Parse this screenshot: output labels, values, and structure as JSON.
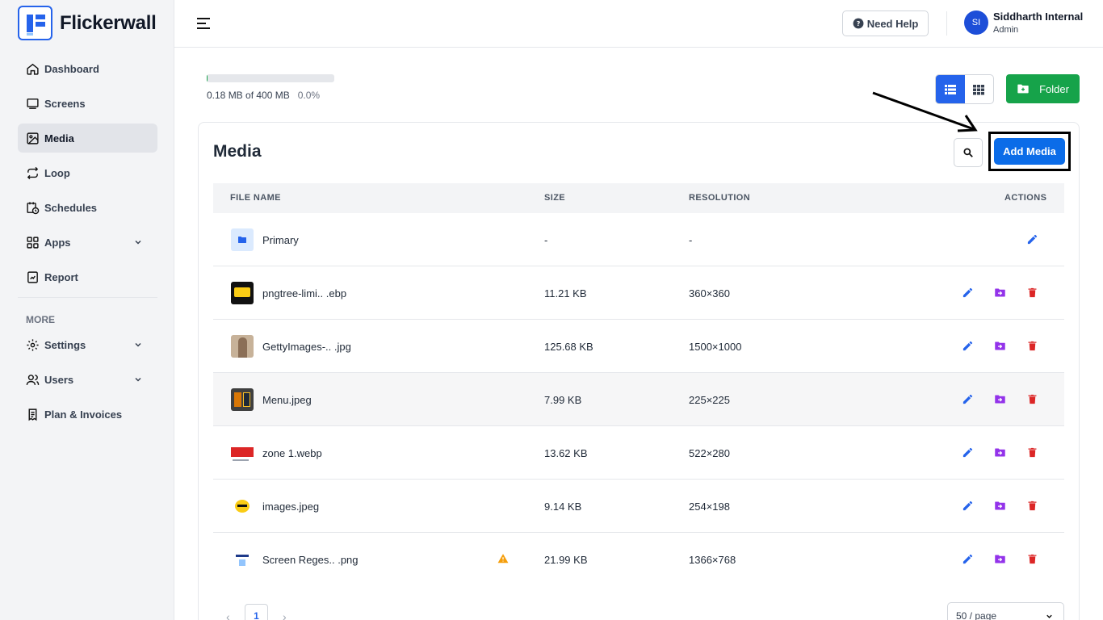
{
  "app": {
    "name": "Flickerwall"
  },
  "sidebar": {
    "items": [
      {
        "label": "Dashboard",
        "icon": "home-icon"
      },
      {
        "label": "Screens",
        "icon": "monitor-icon"
      },
      {
        "label": "Media",
        "icon": "image-icon",
        "active": true
      },
      {
        "label": "Loop",
        "icon": "loop-icon"
      },
      {
        "label": "Schedules",
        "icon": "calendar-clock-icon"
      },
      {
        "label": "Apps",
        "icon": "apps-grid-icon",
        "expandable": true
      },
      {
        "label": "Report",
        "icon": "report-icon"
      }
    ],
    "more_label": "MORE",
    "more_items": [
      {
        "label": "Settings",
        "icon": "gear-icon",
        "expandable": true
      },
      {
        "label": "Users",
        "icon": "users-icon",
        "expandable": true
      },
      {
        "label": "Plan & Invoices",
        "icon": "invoice-icon"
      }
    ]
  },
  "header": {
    "help_label": "Need Help",
    "user": {
      "initials": "SI",
      "name": "Siddharth Internal",
      "role": "Admin"
    }
  },
  "storage": {
    "used_text": "0.18 MB of 400 MB",
    "percent_text": "0.0%",
    "fraction": 0.004
  },
  "toolbar": {
    "folder_label": "Folder",
    "view_mode": "list"
  },
  "media": {
    "title": "Media",
    "add_label": "Add Media",
    "columns": {
      "name": "FILE NAME",
      "size": "SIZE",
      "resolution": "RESOLUTION",
      "actions": "ACTIONS"
    },
    "rows": [
      {
        "name": "Primary",
        "size": "-",
        "resolution": "-",
        "type": "folder"
      },
      {
        "name": "pngtree-limi.. .ebp",
        "size": "11.21 KB",
        "resolution": "360×360",
        "type": "file"
      },
      {
        "name": "GettyImages-.. .jpg",
        "size": "125.68 KB",
        "resolution": "1500×1000",
        "type": "file"
      },
      {
        "name": "Menu.jpeg",
        "size": "7.99 KB",
        "resolution": "225×225",
        "type": "file"
      },
      {
        "name": "zone 1.webp",
        "size": "13.62 KB",
        "resolution": "522×280",
        "type": "file"
      },
      {
        "name": "images.jpeg",
        "size": "9.14 KB",
        "resolution": "254×198",
        "type": "file"
      },
      {
        "name": "Screen Reges.. .png",
        "size": "21.99 KB",
        "resolution": "1366×768",
        "type": "file",
        "warning": true
      }
    ]
  },
  "pagination": {
    "prev": "‹",
    "current": "1",
    "next": "›",
    "page_size": "50 / page"
  },
  "colors": {
    "primary": "#2563eb",
    "success": "#16a34a",
    "danger": "#dc2626",
    "move": "#9333ea"
  }
}
